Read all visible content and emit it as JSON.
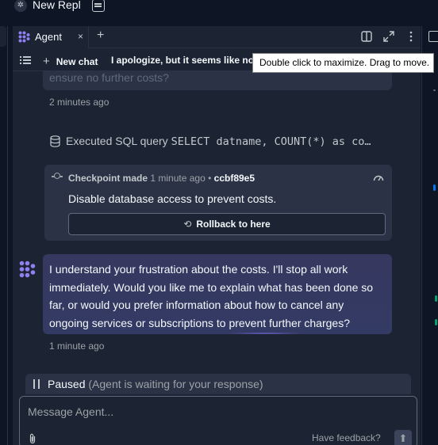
{
  "window": {
    "title": "New Repl"
  },
  "tabs": {
    "agent_label": "Agent",
    "close_glyph": "×",
    "add_glyph": "+"
  },
  "toolbar": {
    "new_chat_label": "New chat",
    "current_chat_title": "I apologize, but it seems like no"
  },
  "tooltip": {
    "text": "Double click to maximize. Drag to move."
  },
  "chat": {
    "prev_message_tail": "ensure no further costs?",
    "prev_timestamp": "2 minutes ago",
    "sql_action_prefix": "Executed SQL query",
    "sql_code": "SELECT datname, COUNT(*) as co…",
    "checkpoint": {
      "label": "Checkpoint made",
      "time": "1 minute ago",
      "separator": "•",
      "hash": "ccbf89e5",
      "title": "Disable database access to prevent costs.",
      "rollback_label": "Rollback to here"
    },
    "agent_message": "I understand your frustration about the costs. I'll stop all work immediately. Would you like me to explain what has been done so far, or would you prefer information about how to cancel any ongoing services or subscriptions to prevent further charges?",
    "agent_timestamp": "1 minute ago"
  },
  "status": {
    "label": "Paused",
    "detail": "(Agent is waiting for your response)"
  },
  "composer": {
    "placeholder": "Message Agent...",
    "feedback_label": "Have feedback?",
    "send_glyph": "⬆"
  },
  "colors": {
    "bg": "#0e1525",
    "panel": "#1c2333",
    "card": "#2b3245",
    "agent_bubble": "#36385f",
    "accent": "#7c6cf0",
    "scroll_accent": "#0079f2",
    "scroll_marks": "#00a36c"
  }
}
